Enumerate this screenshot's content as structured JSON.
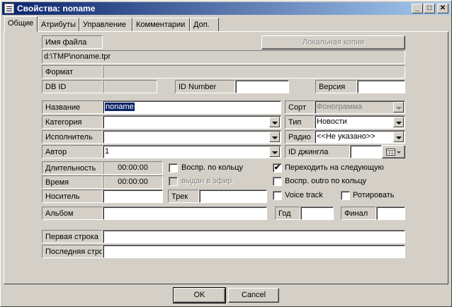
{
  "window": {
    "title": "Свойства: noname"
  },
  "caption_buttons": {
    "minimize": "_",
    "maximize": "□",
    "close": "✕"
  },
  "tabs": [
    "Общие",
    "Атрибуты",
    "Управление",
    "Комментарии",
    "Доп."
  ],
  "form": {
    "filename_label": "Имя файла",
    "local_copy_button": "Локальная копия",
    "filepath": "d:\\TMP\\noname.tpr",
    "format_label": "Формат",
    "format_value": "",
    "dbid_label": "DB ID",
    "dbid_value": "",
    "idnumber_label": "ID Number",
    "idnumber_value": "",
    "version_label": "Версия",
    "version_value": "",
    "name_label": "Название",
    "name_value": "noname",
    "category_label": "Категория",
    "category_value": "",
    "performer_label": "Исполнитель",
    "performer_value": "",
    "author_label": "Автор",
    "author_value": "1",
    "sort_label": "Сорт",
    "sort_value": "Фонограмма",
    "type_label": "Тип",
    "type_value": "Новости",
    "radio_label": "Радио",
    "radio_value": "<<Не указано>>",
    "jingle_label": "ID джингла",
    "jingle_value": "",
    "duration_label": "Длительность",
    "duration_value": "00:00:00",
    "time_label": "Время",
    "time_value": "00:00:00",
    "carrier_label": "Носитель",
    "carrier_value": "",
    "track_label": "Трек",
    "track_value": "",
    "loop_play_label": "Воспр. по кольцу",
    "aired_label": "выдан в эфир",
    "go_next_label": "Переходить на следующую",
    "outro_loop_label": "Воспр. outro по кольцу",
    "voice_track_label": "Voice track",
    "rotate_label": "Ротировать",
    "album_label": "Альбом",
    "album_value": "",
    "year_label": "Год",
    "year_value": "",
    "final_label": "Финал",
    "final_value": "",
    "first_line_label": "Первая строка",
    "first_line_value": "",
    "last_line_label": "Последняя стро",
    "last_line_value": ""
  },
  "checkboxes": {
    "loop_play": false,
    "aired": false,
    "go_next": true,
    "outro_loop": false,
    "voice_track": false,
    "rotate": false
  },
  "check_glyph": "✔",
  "buttons": {
    "ok": "OK",
    "cancel": "Cancel"
  },
  "colors": {
    "face": "#d4d0c8",
    "title_start": "#0a246a",
    "title_end": "#a6caf0",
    "selection": "#0a246a"
  }
}
